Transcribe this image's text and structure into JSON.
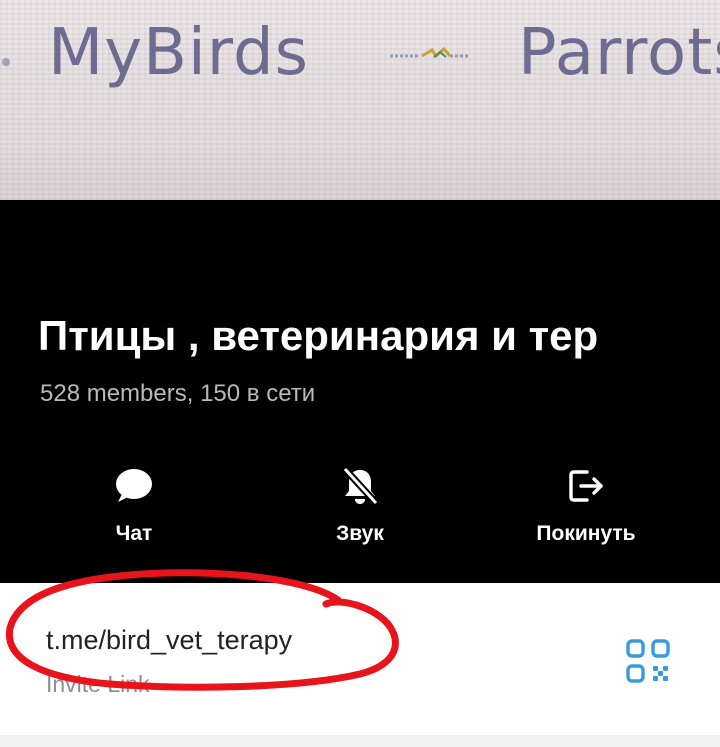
{
  "banner": {
    "left_text": "MyBirds",
    "right_text": "Parrots"
  },
  "group": {
    "title": "Птицы , ветеринария и тер",
    "subtitle": "528 members, 150 в сети"
  },
  "actions": [
    {
      "label": "Чат",
      "icon": "chat-bubble-icon"
    },
    {
      "label": "Звук",
      "icon": "bell-muted-icon"
    },
    {
      "label": "Покинуть",
      "icon": "leave-icon"
    }
  ],
  "invite": {
    "link": "t.me/bird_vet_terapy",
    "caption": "Invite Link",
    "qr_icon": "qr-code-icon"
  },
  "colors": {
    "header_bg": "#000000",
    "accent": "#3a9bd9",
    "highlight": "#e8141b"
  }
}
